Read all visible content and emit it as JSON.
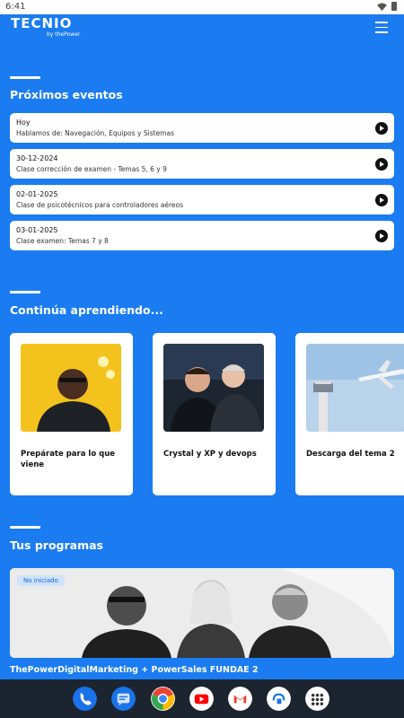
{
  "status": {
    "time": "6:41"
  },
  "header": {
    "logo": "TECNIO",
    "logo_sub": "by thePower"
  },
  "events": {
    "title": "Próximos eventos",
    "items": [
      {
        "date": "Hoy",
        "desc": "Hablamos de: Navegación, Equipos y Sistemas"
      },
      {
        "date": "30-12-2024",
        "desc": "Clase corrección de examen - Temas 5, 6 y 9"
      },
      {
        "date": "02-01-2025",
        "desc": "Clase de psicotécnicos para controladores aéreos"
      },
      {
        "date": "03-01-2025",
        "desc": "Clase examen: Temas 7 y 8"
      }
    ]
  },
  "learning": {
    "title": "Continúa aprendiendo...",
    "cards": [
      {
        "title": "Prepárate para lo que viene"
      },
      {
        "title": "Crystal y XP y devops"
      },
      {
        "title": "Descarga del tema 2"
      }
    ]
  },
  "programs": {
    "title": "Tus programas",
    "badge": "No iniciado",
    "name": "ThePowerDigitalMarketing + PowerSales FUNDAE 2"
  },
  "colors": {
    "background": "#1a7cf0",
    "card": "#ffffff"
  },
  "nav_icons": [
    "phone-icon",
    "messages-icon",
    "chrome-icon",
    "youtube-icon",
    "gmail-icon",
    "app-icon",
    "app-drawer-icon"
  ]
}
